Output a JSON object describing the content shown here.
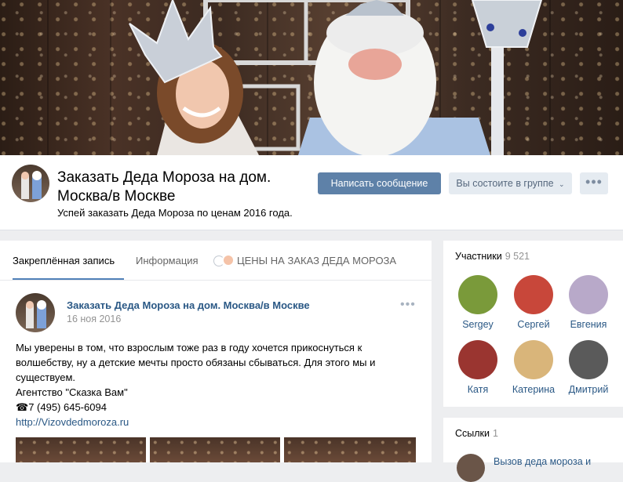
{
  "group": {
    "title": "Заказать Деда Мороза на дом. Москва/в Москве",
    "status": "Успей заказать Деда Мороза по ценам 2016 года."
  },
  "actions": {
    "message": "Написать сообщение",
    "member_state": "Вы состоите в группе",
    "more": "•••"
  },
  "tabs": [
    {
      "label": "Закреплённая запись"
    },
    {
      "label": "Информация"
    },
    {
      "label": "ЦЕНЫ НА ЗАКАЗ ДЕДА МОРОЗА"
    }
  ],
  "post": {
    "author": "Заказать Деда Мороза на дом. Москва/в Москве",
    "date": "16 ноя 2016",
    "more": "•••",
    "text_lines": [
      "Мы уверены в том, что взрослым тоже раз в году хочется прикоснуться к",
      "волшебству, ну а детские мечты просто обязаны сбываться. Для этого мы и",
      "существуем.",
      "Агентство \"Сказка Вам\"",
      "☎7 (495) 645-6094"
    ],
    "link": "http://Vizovdedmoroza.ru"
  },
  "members": {
    "title": "Участники",
    "count": "9 521",
    "items": [
      {
        "name": "Sergey",
        "color": "#7a9a3a"
      },
      {
        "name": "Сергей",
        "color": "#c8473a"
      },
      {
        "name": "Евгения",
        "color": "#b8a9c9"
      },
      {
        "name": "Катя",
        "color": "#9a3530"
      },
      {
        "name": "Катерина",
        "color": "#d9b57a"
      },
      {
        "name": "Дмитрий",
        "color": "#5a5a5a"
      }
    ]
  },
  "links": {
    "title": "Ссылки",
    "count": "1",
    "first": "Вызов деда мороза и"
  },
  "colors": {
    "accent": "#5181b8",
    "link": "#2a5885",
    "button": "#5e81a8"
  }
}
